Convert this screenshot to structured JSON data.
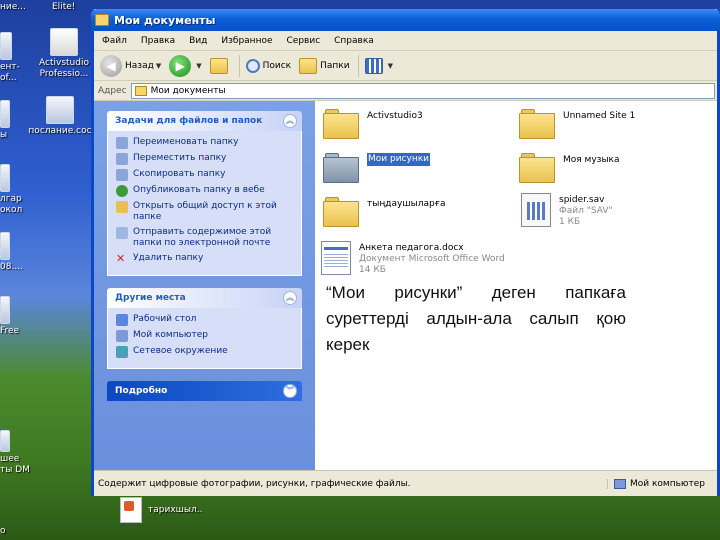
{
  "desktop": {
    "icons": [
      {
        "label": "ние..."
      },
      {
        "label": "Elite!"
      },
      {
        "label": "ент-\nоf..."
      },
      {
        "label": "Activstudio\nProfessio..."
      },
      {
        "label": "послание.coc"
      },
      {
        "label": "ы"
      },
      {
        "label": "лгар\nокол"
      },
      {
        "label": "08...."
      },
      {
        "label": "Free"
      },
      {
        "label": "шее\nты DM"
      },
      {
        "label": "о"
      }
    ],
    "taskbar_item": "тарихшыл.."
  },
  "window": {
    "title": "Мои документы",
    "menu": [
      "Файл",
      "Правка",
      "Вид",
      "Избранное",
      "Сервис",
      "Справка"
    ],
    "toolbar": {
      "back": "Назад",
      "search": "Поиск",
      "folders": "Папки"
    },
    "address": {
      "label": "Адрес",
      "value": "Мои документы"
    },
    "tasks_panel": {
      "title": "Задачи для файлов и папок",
      "items": [
        "Переименовать папку",
        "Переместить папку",
        "Скопировать папку",
        "Опубликовать папку в вебе",
        "Открыть общий доступ к этой папке",
        "Отправить содержимое этой папки по электронной почте",
        "Удалить папку"
      ]
    },
    "places_panel": {
      "title": "Другие места",
      "items": [
        "Рабочий стол",
        "Мой компьютер",
        "Сетевое окружение"
      ]
    },
    "details_panel": {
      "title": "Подробно"
    },
    "files": [
      {
        "name": "Activstudio3",
        "type": "folder"
      },
      {
        "name": "Unnamed Site 1",
        "type": "folder"
      },
      {
        "name": "Мои рисунки",
        "type": "folder",
        "selected": true
      },
      {
        "name": "Моя музыка",
        "type": "folder"
      },
      {
        "name": "тыңдаушыларға",
        "type": "folder"
      },
      {
        "name": "spider.sav",
        "sub1": "Файл \"SAV\"",
        "sub2": "1 КБ",
        "type": "file"
      },
      {
        "name": "Анкета педагога.docx",
        "sub1": "Документ Microsoft Office Word",
        "sub2": "14 КБ",
        "type": "doc"
      }
    ],
    "status": {
      "text": "Содержит цифровые фотографии, рисунки, графические файлы.",
      "location": "Мой компьютер"
    }
  },
  "overlay_text": "“Мои рисунки” деген папкаға суреттерді алдын-ала салып қою керек"
}
